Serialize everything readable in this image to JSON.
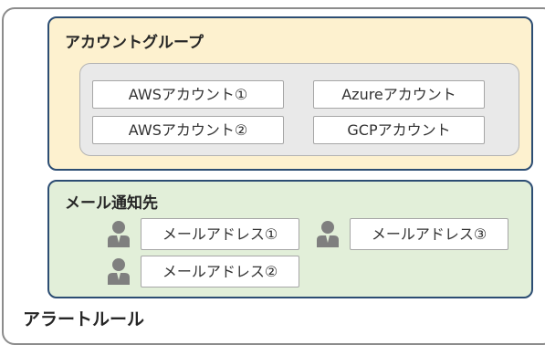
{
  "alert_rule": {
    "label": "アラートルール"
  },
  "account_group": {
    "label": "アカウントグループ",
    "accounts": [
      "AWSアカウント①",
      "Azureアカウント",
      "AWSアカウント②",
      "GCPアカウント"
    ]
  },
  "notification": {
    "label": "メール通知先",
    "addresses": [
      "メールアドレス①",
      "メールアドレス③",
      "メールアドレス②"
    ]
  },
  "colors": {
    "group_fill": "#fdf1cf",
    "notify_fill": "#e2efd9",
    "border_blue": "#2c4d73",
    "person_icon": "#7f7f7f"
  }
}
